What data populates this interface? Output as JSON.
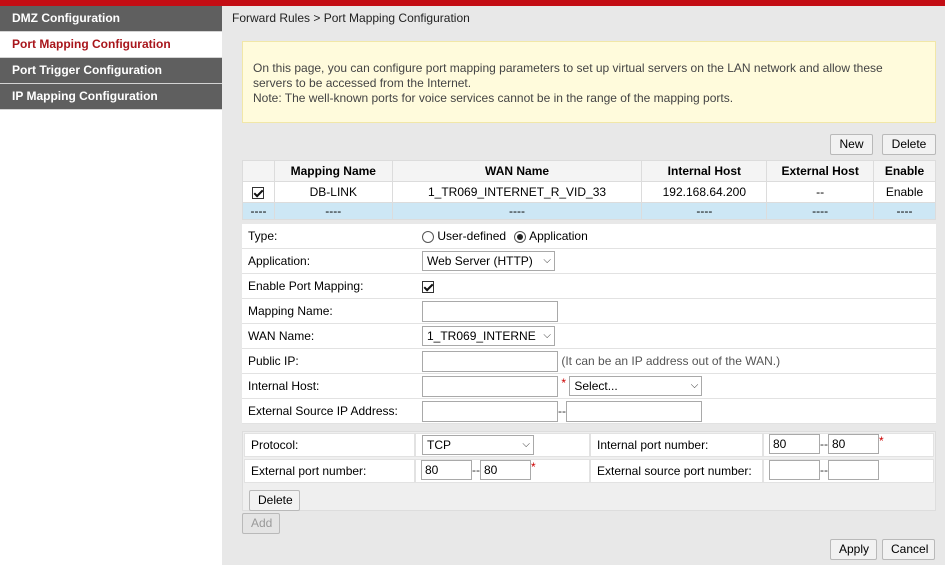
{
  "sidebar": {
    "items": [
      {
        "label": "DMZ Configuration"
      },
      {
        "label": "Port Mapping Configuration"
      },
      {
        "label": "Port Trigger Configuration"
      },
      {
        "label": "IP Mapping Configuration"
      }
    ]
  },
  "breadcrumb": "Forward Rules > Port Mapping Configuration",
  "notice": {
    "line1": "On this page, you can configure port mapping parameters to set up virtual servers on the LAN network and allow these",
    "line2": "servers to be accessed from the Internet.",
    "line3": "Note: The well-known ports for voice services cannot be in the range of the mapping ports."
  },
  "toolbar": {
    "new_label": "New",
    "delete_label": "Delete"
  },
  "table": {
    "headers": [
      "",
      "Mapping Name",
      "WAN Name",
      "Internal Host",
      "External Host",
      "Enable"
    ],
    "rows": [
      {
        "name": "DB-LINK",
        "wan": "1_TR069_INTERNET_R_VID_33",
        "internal": "192.168.64.200",
        "external": "--",
        "enable": "Enable"
      },
      {
        "sel": "----",
        "name": "----",
        "wan": "----",
        "internal": "----",
        "external": "----",
        "enable": "----"
      }
    ]
  },
  "form": {
    "type_label": "Type:",
    "type_opt1": "User-defined",
    "type_opt2": "Application",
    "application_label": "Application:",
    "application_value": "Web Server (HTTP)",
    "enable_label": "Enable Port Mapping:",
    "mapping_name_label": "Mapping Name:",
    "mapping_name_value": "",
    "wan_label": "WAN Name:",
    "wan_value": "1_TR069_INTERNE",
    "public_ip_label": "Public IP:",
    "public_ip_hint": "(It can be an IP address out of the WAN.)",
    "internal_host_label": "Internal Host:",
    "internal_host_select": "Select...",
    "ext_src_label": "External Source IP Address:"
  },
  "ports": {
    "protocol_label": "Protocol:",
    "protocol_value": "TCP",
    "internal_port_label": "Internal port number:",
    "internal_port_start": "80",
    "internal_port_end": "80",
    "external_port_label": "External port number:",
    "external_port_start": "80",
    "external_port_end": "80",
    "ext_src_port_label": "External source port number:",
    "delete_label": "Delete"
  },
  "footer": {
    "add_label": "Add",
    "apply_label": "Apply",
    "cancel_label": "Cancel"
  }
}
